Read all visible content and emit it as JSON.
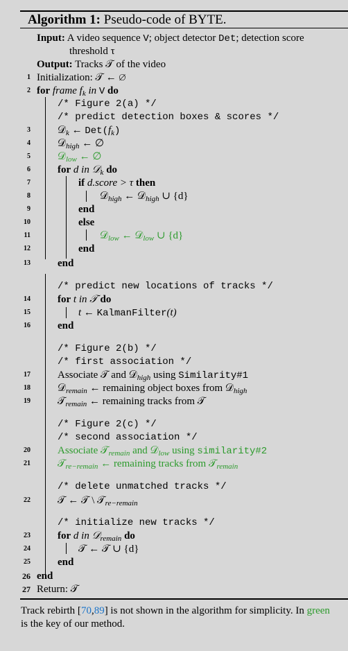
{
  "algorithm": {
    "label": "Algorithm 1:",
    "title": "Pseudo-code of BYTE."
  },
  "input": {
    "label": "Input:",
    "line1_a": "A video sequence ",
    "line1_v": "V",
    "line1_b": "; object detector ",
    "line1_det": "Det",
    "line1_c": "; detection score",
    "line2": "threshold τ"
  },
  "output": {
    "label": "Output:",
    "text": "Tracks 𝒯 of the video"
  },
  "steps": {
    "s1": {
      "num": "1",
      "text": "Initialization: 𝒯 ← ∅"
    },
    "s2": {
      "num": "2",
      "kw_for": "for",
      "frame": "frame f",
      "sub_k": "k",
      "in": " in ",
      "v": "V",
      "kw_do": "do"
    },
    "c_fig2a": "/* Figure 2(a) */",
    "c_predict_det": "/* predict detection boxes & scores */",
    "s3": {
      "num": "3",
      "lhs": "𝒟",
      "sub": "k",
      "arrow": " ← ",
      "fn": "Det(",
      "arg": "f",
      "arg_sub": "k",
      "close": ")"
    },
    "s4": {
      "num": "4",
      "lhs": "𝒟",
      "sub": "high",
      "rhs": " ← ∅"
    },
    "s5": {
      "num": "5",
      "lhs": "𝒟",
      "sub": "low",
      "rhs": " ← ∅"
    },
    "s6": {
      "num": "6",
      "kw_for": "for",
      "d": " d in 𝒟",
      "sub": "k",
      "kw_do": "do"
    },
    "s7": {
      "num": "7",
      "kw_if": "if",
      "cond": " d.score > τ ",
      "kw_then": "then"
    },
    "s8": {
      "num": "8",
      "lhs": "𝒟",
      "sub1": "high",
      "mid": " ← 𝒟",
      "sub2": "high",
      "rhs": " ∪ {d}"
    },
    "s9": {
      "num": "9",
      "kw": "end"
    },
    "s10": {
      "num": "10",
      "kw": "else"
    },
    "s11": {
      "num": "11",
      "lhs": "𝒟",
      "sub1": "low",
      "mid": " ← 𝒟",
      "sub2": "low",
      "rhs": " ∪ {d}"
    },
    "s12": {
      "num": "12",
      "kw": "end"
    },
    "s13": {
      "num": "13",
      "kw": "end"
    },
    "c_predict_loc": "/* predict new locations of tracks */",
    "s14": {
      "num": "14",
      "kw_for": "for",
      "t": " t in 𝒯 ",
      "kw_do": "do"
    },
    "s15": {
      "num": "15",
      "pre": "t ← ",
      "fn": "KalmanFilter",
      "arg": "(t)"
    },
    "s16": {
      "num": "16",
      "kw": "end"
    },
    "c_fig2b": "/* Figure 2(b) */",
    "c_first": "/* first association */",
    "s17": {
      "num": "17",
      "pre": "Associate 𝒯 and 𝒟",
      "sub": "high",
      "mid": " using ",
      "fn": "Similarity#1"
    },
    "s18": {
      "num": "18",
      "lhs": "𝒟",
      "sub1": "remain",
      "mid": " ← remaining object boxes from 𝒟",
      "sub2": "high"
    },
    "s19": {
      "num": "19",
      "lhs": "𝒯",
      "sub": "remain",
      "rhs": " ← remaining tracks from 𝒯"
    },
    "c_fig2c": "/* Figure 2(c) */",
    "c_second": "/* second association */",
    "s20": {
      "num": "20",
      "pre": "Associate 𝒯",
      "sub1": "remain",
      "mid": " and 𝒟",
      "sub2": "low",
      "using": " using ",
      "fn": "similarity#2"
    },
    "s21": {
      "num": "21",
      "lhs": "𝒯",
      "sub1": "re−remain",
      "mid": " ← remaining tracks from 𝒯",
      "sub2": "remain"
    },
    "c_delete": "/* delete unmatched tracks */",
    "s22": {
      "num": "22",
      "pre": "𝒯 ← 𝒯 \\ 𝒯",
      "sub": "re−remain"
    },
    "c_init": "/* initialize new tracks */",
    "s23": {
      "num": "23",
      "kw_for": "for",
      "d": " d in 𝒟",
      "sub": "remain",
      "kw_do": " do"
    },
    "s24": {
      "num": "24",
      "text": "𝒯 ← 𝒯 ∪ {d}"
    },
    "s25": {
      "num": "25",
      "kw": "end"
    },
    "s26": {
      "num": "26",
      "kw": "end"
    },
    "s27": {
      "num": "27",
      "text": "Return: 𝒯"
    }
  },
  "caption": {
    "line1_a": "Track rebirth [",
    "ref1": "70",
    "comma": ",",
    "ref2": "89",
    "line1_b": "] is not shown in the algorithm for simplicity. In ",
    "green_word": "green",
    "line2": "is the key of our method."
  },
  "colors": {
    "highlight_green": "#2c9a2c",
    "citation_blue": "#1a73c8",
    "background": "#d7d7d7"
  }
}
